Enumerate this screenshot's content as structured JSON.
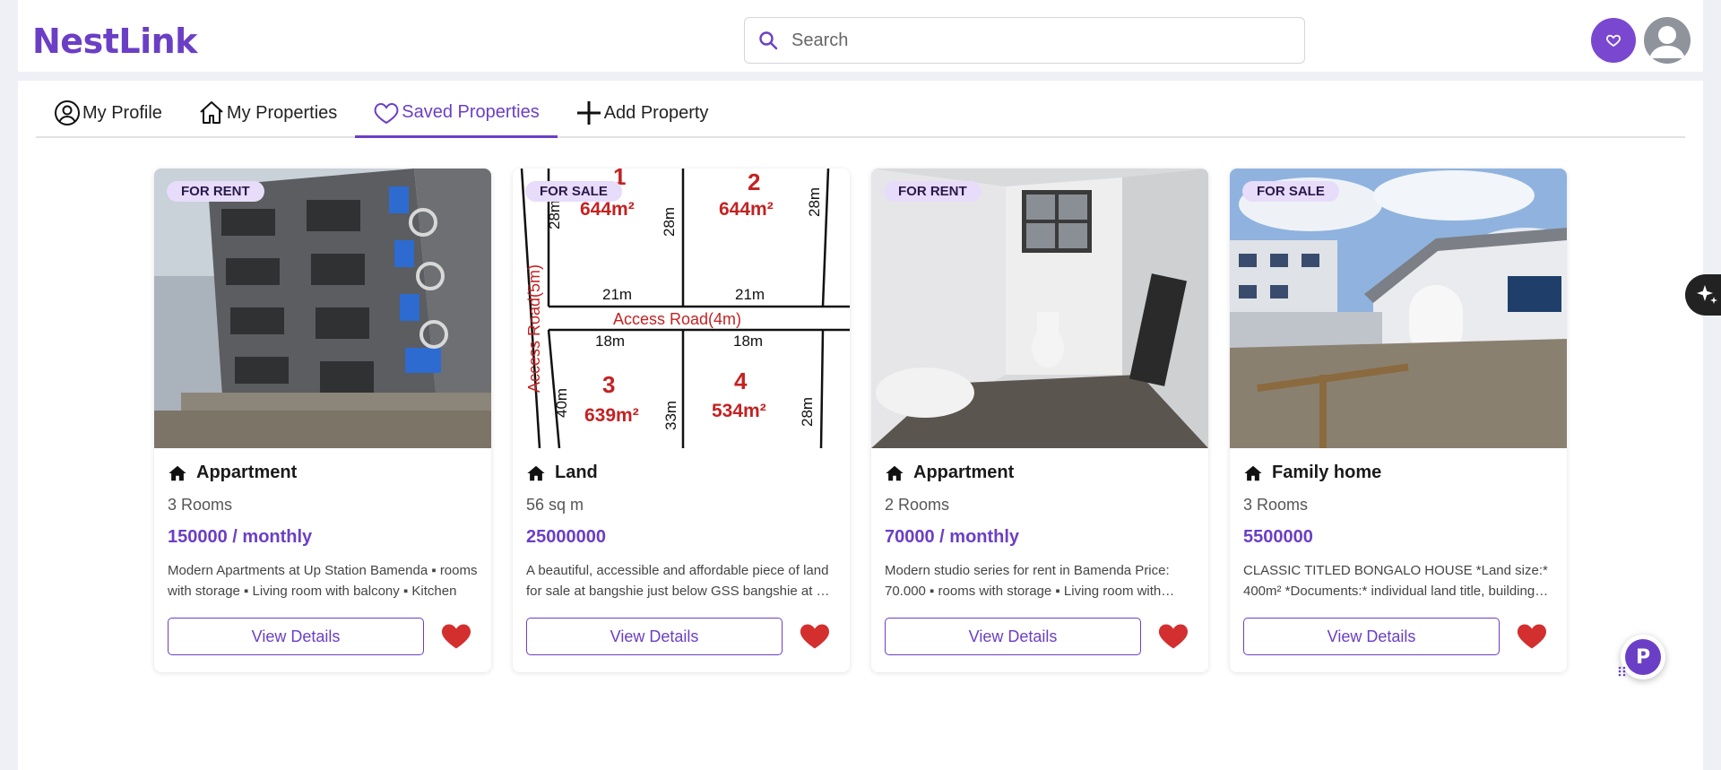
{
  "app": {
    "logo": "NestLink"
  },
  "header": {
    "search_placeholder": "Search"
  },
  "tabs": [
    {
      "label": "My Profile",
      "icon": "user-circle-icon",
      "active": false
    },
    {
      "label": "My Properties",
      "icon": "home-icon",
      "active": false
    },
    {
      "label": "Saved Properties",
      "icon": "heart-icon",
      "active": true
    },
    {
      "label": "Add Property",
      "icon": "plus-icon",
      "active": false
    }
  ],
  "cards": [
    {
      "badge": "FOR RENT",
      "type": "Appartment",
      "size": "3 Rooms",
      "price": "150000 / monthly",
      "description": "Modern Apartments at Up Station Bamenda ▪ rooms with storage ▪ Living room with balcony ▪ Kitchen",
      "button": "View Details",
      "image": "apartment-building-photo"
    },
    {
      "badge": "FOR SALE",
      "type": "Land",
      "size": "56 sq m",
      "price": "25000000",
      "description": "A beautiful, accessible and affordable piece of land for sale at bangshie just below GSS bangshie at up station",
      "button": "View Details",
      "image": "land-plot-map",
      "plot_map": {
        "road_h": "Access Road(4m)",
        "road_v": "Access Road(5m)",
        "plots": [
          {
            "number": "1",
            "area": "644m²"
          },
          {
            "number": "2",
            "area": "644m²"
          },
          {
            "number": "3",
            "area": "639m²"
          },
          {
            "number": "4",
            "area": "534m²"
          }
        ],
        "dims": [
          "28m",
          "28m",
          "28m",
          "21m",
          "21m",
          "18m",
          "18m",
          "40m",
          "33m",
          "28m"
        ]
      }
    },
    {
      "badge": "FOR RENT",
      "type": "Appartment",
      "size": "2 Rooms",
      "price": "70000 / monthly",
      "description": "Modern studio series for rent in Bamenda Price: 70.000 ▪ rooms with storage ▪ Living room with balcony",
      "button": "View Details",
      "image": "bathroom-photo"
    },
    {
      "badge": "FOR SALE",
      "type": "Family home",
      "size": "3 Rooms",
      "price": "5500000",
      "description": "CLASSIC TITLED BONGALO HOUSE *Land size:* 400m² *Documents:* individual land title, building permit",
      "button": "View Details",
      "image": "family-house-photo"
    }
  ],
  "colors": {
    "brand": "#6b3fc5",
    "heart": "#d32f2f",
    "badge_bg": "#e7dcfa"
  },
  "widget": {
    "letter": "P"
  }
}
